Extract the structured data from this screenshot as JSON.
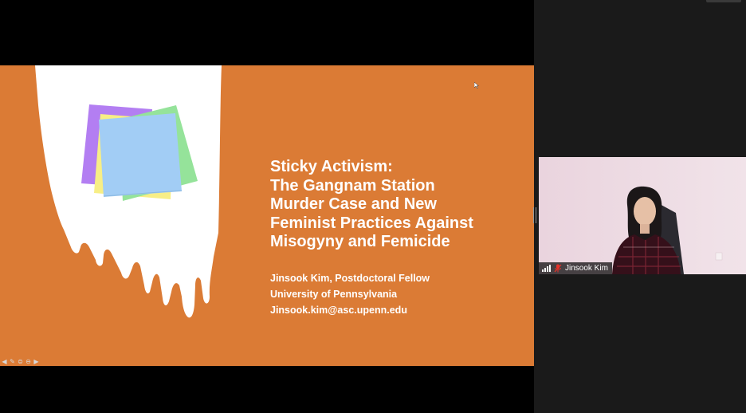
{
  "slide": {
    "title_lines": [
      "Sticky Activism:",
      "The Gangnam Station",
      "Murder Case and New",
      "Feminist Practices Against",
      "Misogyny and Femicide"
    ],
    "author": "Jinsook Kim, Postdoctoral Fellow",
    "affiliation": "University of Pennsylvania",
    "email": "Jinsook.kim@asc.upenn.edu",
    "colors": {
      "background": "#db7b35",
      "text": "#ffffff",
      "note_purple": "#b37ef2",
      "note_yellow": "#f7ee86",
      "note_green": "#95e39a",
      "note_blue": "#a2cdf5"
    },
    "controls": [
      "prev-icon",
      "pen-icon",
      "menu-icon",
      "zoom-icon",
      "next-icon"
    ]
  },
  "participant": {
    "name": "Jinsook Kim",
    "audio": "muted",
    "icons": [
      "signal-bars-icon",
      "mic-muted-icon"
    ]
  },
  "theme": {
    "share_background": "#000000",
    "gallery_background": "#1a1a1a",
    "muted_color": "#e5312a"
  }
}
